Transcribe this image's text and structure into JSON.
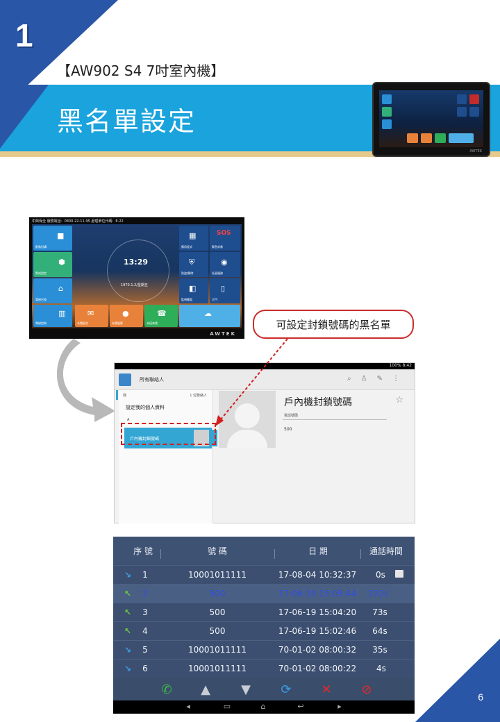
{
  "slide": {
    "step_number": "1",
    "subtitle": "【AW902 S4 7吋室內機】",
    "title": "黑名單設定",
    "page_number": "6",
    "accent_color": "#1aa3dd",
    "dark_color": "#2a56a8"
  },
  "home_screen": {
    "status_text": "中興保全 服務電話：0800-22-11-95 處理單位代碼：E-22",
    "time": "13:29",
    "date": "1970.1.2/星期五",
    "brand": "AWTEK",
    "tiles": [
      "影像對講",
      "警戒設定",
      "電梯召喚",
      "電梯控制",
      "未讀留言",
      "未讀留影",
      "未接來電",
      "應用程式",
      "緊急求救",
      "防盜/解除",
      "社區服務",
      "監視畫面",
      "大門"
    ]
  },
  "callout": {
    "text": "可設定封鎖號碼的黑名單"
  },
  "contacts_app": {
    "status_time": "100% 8:42",
    "app_title": "所有聯絡人",
    "list_header": "我",
    "list_count": "1 位聯絡人",
    "me_entry": "設定我的個人資料",
    "section": "A",
    "contact_name": "戶內機封鎖號碼",
    "detail_field_label": "電話號碼",
    "detail_number": "500",
    "action_icons": [
      "search-icon",
      "add-contact-icon",
      "edit-icon",
      "overflow-menu-icon"
    ]
  },
  "call_log": {
    "columns": [
      "序 號",
      "號 碼",
      "日 期",
      "通話時間"
    ],
    "rows": [
      {
        "type": "incoming",
        "index": "1",
        "number": "10001011111",
        "date": "17-08-04 10:32:37",
        "duration": "0s",
        "selected": false
      },
      {
        "type": "outgoing",
        "index": "2",
        "number": "500",
        "date": "17-06-19 15:05:44",
        "duration": "232s",
        "selected": true
      },
      {
        "type": "outgoing",
        "index": "3",
        "number": "500",
        "date": "17-06-19 15:04:20",
        "duration": "73s",
        "selected": false
      },
      {
        "type": "outgoing",
        "index": "4",
        "number": "500",
        "date": "17-06-19 15:02:46",
        "duration": "64s",
        "selected": false
      },
      {
        "type": "incoming",
        "index": "5",
        "number": "10001011111",
        "date": "70-01-02 08:00:32",
        "duration": "35s",
        "selected": false
      },
      {
        "type": "incoming",
        "index": "6",
        "number": "10001011111",
        "date": "70-01-02 08:00:22",
        "duration": "4s",
        "selected": false
      }
    ],
    "toolbar_icons": [
      "call-icon",
      "up-arrow-icon",
      "down-arrow-icon",
      "sync-icon",
      "delete-icon",
      "block-icon"
    ],
    "nav_icons": [
      "volume-down-icon",
      "recent-apps-icon",
      "home-icon",
      "back-icon",
      "volume-up-icon"
    ]
  }
}
